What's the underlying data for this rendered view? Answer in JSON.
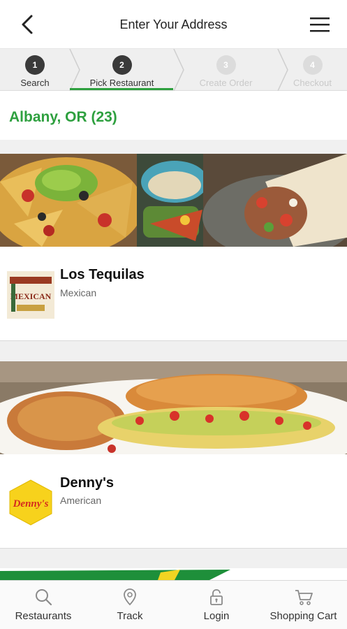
{
  "header": {
    "title": "Enter Your Address"
  },
  "steps": [
    {
      "number": "1",
      "label": "Search",
      "state": "done"
    },
    {
      "number": "2",
      "label": "Pick Restaurant",
      "state": "current"
    },
    {
      "number": "3",
      "label": "Create Order",
      "state": "upcoming"
    },
    {
      "number": "4",
      "label": "Checkout",
      "state": "upcoming"
    }
  ],
  "location": {
    "heading": "Albany, OR (23)"
  },
  "restaurants": [
    {
      "name": "Los Tequilas",
      "cuisine": "Mexican",
      "logo_text": "MEXICAN"
    },
    {
      "name": "Denny's",
      "cuisine": "American",
      "logo_text": "Denny's"
    }
  ],
  "bottom_nav": [
    {
      "label": "Restaurants",
      "icon": "search-icon"
    },
    {
      "label": "Track",
      "icon": "location-pin-icon"
    },
    {
      "label": "Login",
      "icon": "lock-icon"
    },
    {
      "label": "Shopping Cart",
      "icon": "cart-icon"
    }
  ],
  "colors": {
    "accent": "#2ea03f",
    "step_active": "#3a3a3a",
    "step_inactive": "#dcdcdc"
  }
}
